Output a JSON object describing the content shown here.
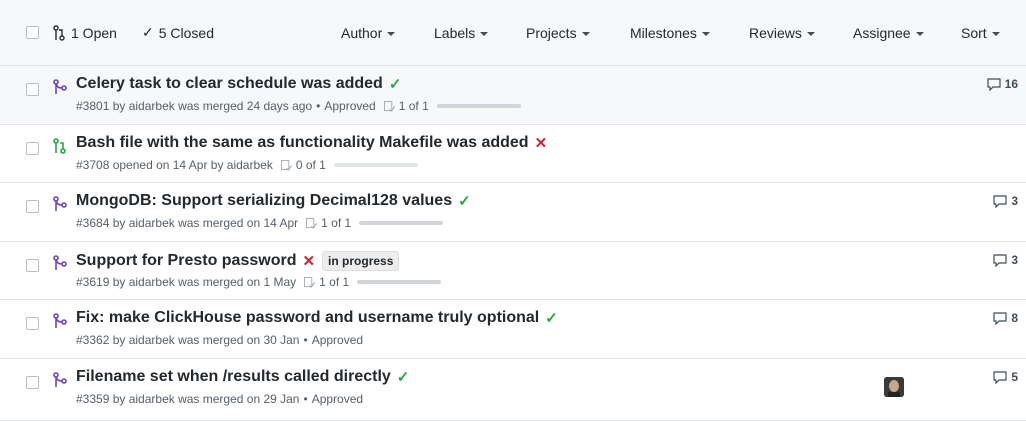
{
  "header": {
    "open_label": "1 Open",
    "closed_label": "5 Closed",
    "filters": [
      "Author",
      "Labels",
      "Projects",
      "Milestones",
      "Reviews",
      "Assignee",
      "Sort"
    ]
  },
  "pull_requests": [
    {
      "title": "Celery task to clear schedule was added",
      "state": "merged",
      "status": "success",
      "meta": "#3801 by aidarbek was merged 24 days ago",
      "approved": "Approved",
      "review": "1 of 1",
      "review_fraction": 1.0,
      "comments": "16",
      "label": ""
    },
    {
      "title": "Bash file with the same as functionality Makefile was added",
      "state": "open",
      "status": "failure",
      "meta": "#3708 opened on 14 Apr by aidarbek",
      "approved": "",
      "review": "0 of 1",
      "review_fraction": 0.0,
      "comments": "",
      "label": ""
    },
    {
      "title": "MongoDB: Support serializing Decimal128 values",
      "state": "merged",
      "status": "success",
      "meta": "#3684 by aidarbek was merged on 14 Apr",
      "approved": "",
      "review": "1 of 1",
      "review_fraction": 1.0,
      "comments": "3",
      "label": ""
    },
    {
      "title": "Support for Presto password",
      "state": "merged",
      "status": "failure",
      "meta": "#3619 by aidarbek was merged on 1 May",
      "approved": "",
      "review": "1 of 1",
      "review_fraction": 1.0,
      "comments": "3",
      "label": "in progress"
    },
    {
      "title": "Fix: make ClickHouse password and username truly optional",
      "state": "merged",
      "status": "success",
      "meta": "#3362 by aidarbek was merged on 30 Jan",
      "approved": "Approved",
      "review": "",
      "review_fraction": 0,
      "comments": "8",
      "label": ""
    },
    {
      "title": "Filename set when /results called directly",
      "state": "merged",
      "status": "success",
      "meta": "#3359 by aidarbek was merged on 29 Jan",
      "approved": "Approved",
      "review": "",
      "review_fraction": 0,
      "comments": "5",
      "label": "",
      "has_avatar": true
    }
  ],
  "colors": {
    "merged": "#6f42c1",
    "open": "#28a745",
    "success": "#28a745",
    "failure": "#cb2431"
  }
}
